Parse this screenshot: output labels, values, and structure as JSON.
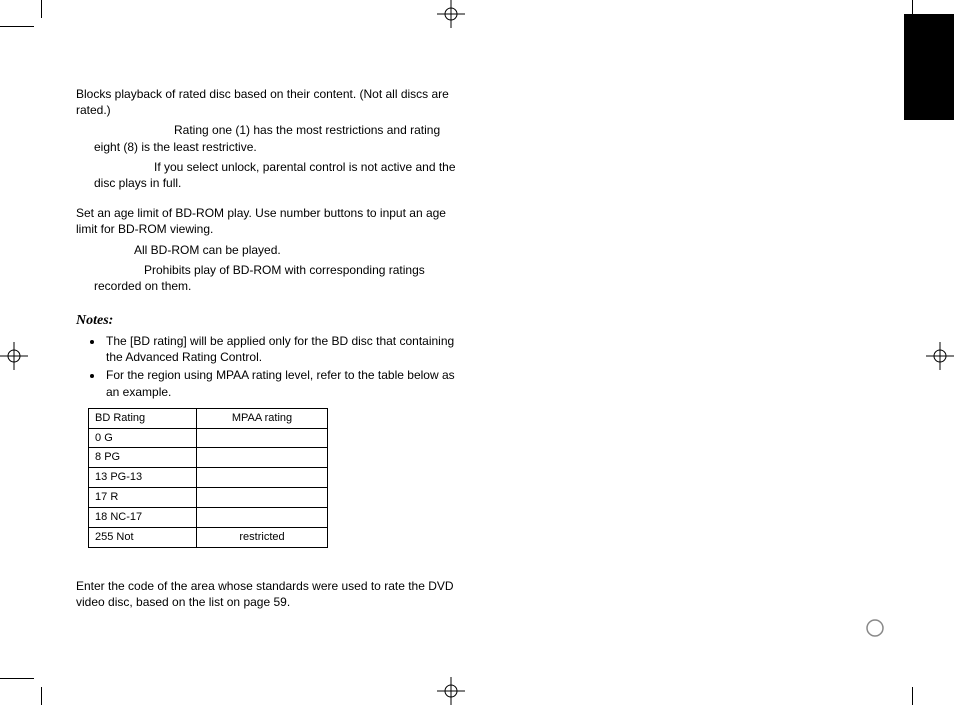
{
  "body": {
    "p1": "Blocks playback of rated disc based on their content. (Not all discs are rated.)",
    "p2": "Rating one (1) has the most restrictions and rating eight (8) is the least restrictive.",
    "p3": "If you select unlock, parental control is not active and the disc plays in full.",
    "p4": "Set an age limit of BD-ROM play. Use number buttons to input an age limit for BD-ROM viewing.",
    "p5": "All BD-ROM can be played.",
    "p6": "Prohibits play of BD-ROM with corresponding ratings recorded on them.",
    "notes_heading": "Notes:",
    "note1": "The [BD rating] will be applied only for the BD disc that containing the Advanced Rating Control.",
    "note2": "For the region using MPAA rating level, refer to the table below as an example.",
    "p7": "Enter the code of the area whose standards were used to rate the DVD video disc, based on the list on page 59."
  },
  "table": {
    "head_left": "BD Rating",
    "head_right": "MPAA rating",
    "rows": [
      {
        "bd": "0",
        "mpaa": "G"
      },
      {
        "bd": "8",
        "mpaa": "PG"
      },
      {
        "bd": "13",
        "mpaa": "PG-13"
      },
      {
        "bd": "17",
        "mpaa": "R"
      },
      {
        "bd": "18",
        "mpaa": "NC-17"
      },
      {
        "bd": "255",
        "mpaa": "Not",
        "extra": "restricted"
      }
    ]
  }
}
